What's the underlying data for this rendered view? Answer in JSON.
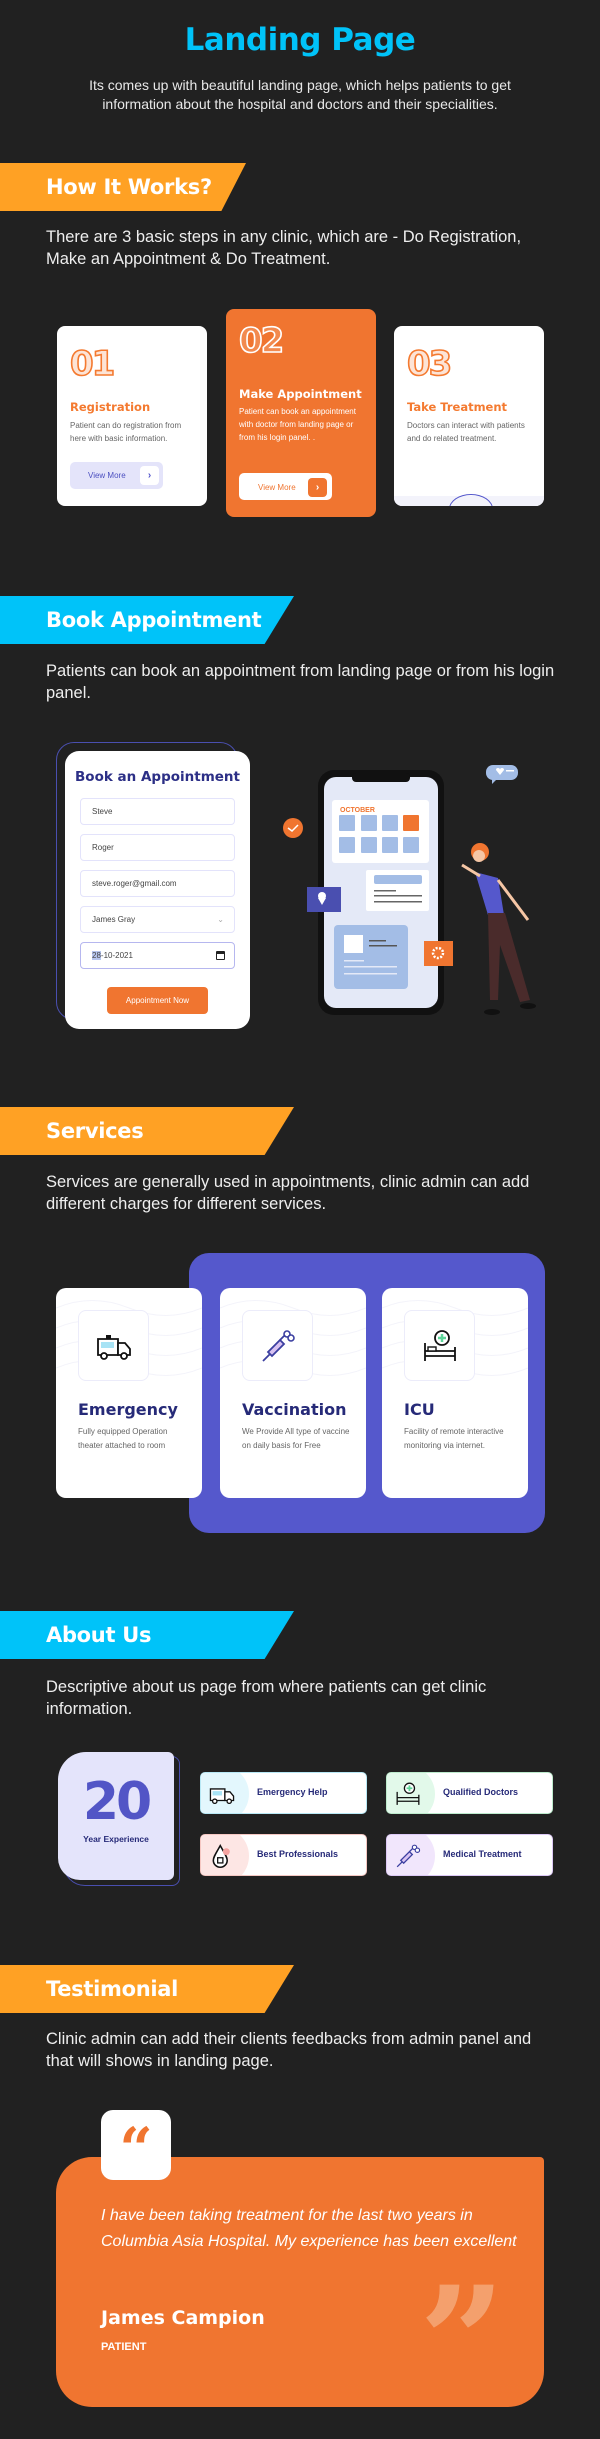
{
  "header": {
    "title": "Landing Page",
    "subtitle": "Its comes up with beautiful landing page, which helps patients to get information about the hospital and doctors and their specialities."
  },
  "how_it_works": {
    "heading": "How It Works?",
    "description": "There are 3 basic steps in any clinic, which are - Do Registration, Make an Appointment & Do Treatment.",
    "steps": [
      {
        "number": "01",
        "title": "Registration",
        "text": "Patient can do registration from here with basic information.",
        "button": "View More"
      },
      {
        "number": "02",
        "title": "Make Appointment",
        "text": "Patient can book an appointment with doctor from landing page or from his login panel. .",
        "button": "View More"
      },
      {
        "number": "03",
        "title": "Take Treatment",
        "text": "Doctors can interact with patients and do related treatment."
      }
    ],
    "arrow_glyph": "›"
  },
  "book_appointment": {
    "heading": "Book Appointment",
    "description": "Patients can book an appointment from landing page or from his login panel.",
    "form": {
      "title": "Book an Appointment",
      "first_name": "Steve",
      "last_name": "Roger",
      "email": "steve.roger@gmail.com",
      "doctor": "James Gray",
      "date_day": "28",
      "date_rest": "-10-2021",
      "submit": "Appointment Now"
    },
    "illustration": {
      "calendar_month": "OCTOBER"
    }
  },
  "services": {
    "heading": "Services",
    "description": "Services are generally used in appointments, clinic admin can add different charges for different services.",
    "items": [
      {
        "icon": "ambulance-icon",
        "title": "Emergency",
        "text": "Fully equipped Operation theater attached to room"
      },
      {
        "icon": "syringe-icon",
        "title": "Vaccination",
        "text": "We Provide All type of vaccine on daily basis for Free"
      },
      {
        "icon": "hospital-bed-icon",
        "title": "ICU",
        "text": "Facility of remote interactive monitoring via internet."
      }
    ]
  },
  "about": {
    "heading": "About Us",
    "description": "Descriptive about us page from where patients can get clinic information.",
    "experience_number": "20",
    "experience_label": "Year Experience",
    "features": [
      {
        "icon": "ambulance-icon",
        "label": "Emergency Help",
        "color": "#e3f7fd"
      },
      {
        "icon": "hospital-bed-icon",
        "label": "Qualified Doctors",
        "color": "#e2f9ea"
      },
      {
        "icon": "blood-drop-icon",
        "label": "Best Professionals",
        "color": "#fde6e4"
      },
      {
        "icon": "syringe-icon",
        "label": "Medical Treatment",
        "color": "#f1e6fc"
      }
    ]
  },
  "testimonial": {
    "heading": "Testimonial",
    "description": "Clinic admin can add their clients feedbacks from admin panel and that will shows in landing page.",
    "quote": "I have been taking treatment for the last two years in Columbia Asia Hospital. My experience has been excellent",
    "name": "James Campion",
    "role": "PATIENT",
    "open_quote_glyph": "“",
    "close_quote_glyph": "”"
  },
  "colors": {
    "background": "#212121",
    "accent_blue": "#00c3f9",
    "accent_orange": "#ffa124",
    "card_orange": "#f07530",
    "indigo": "#5558cc",
    "navy_text": "#262a78"
  }
}
